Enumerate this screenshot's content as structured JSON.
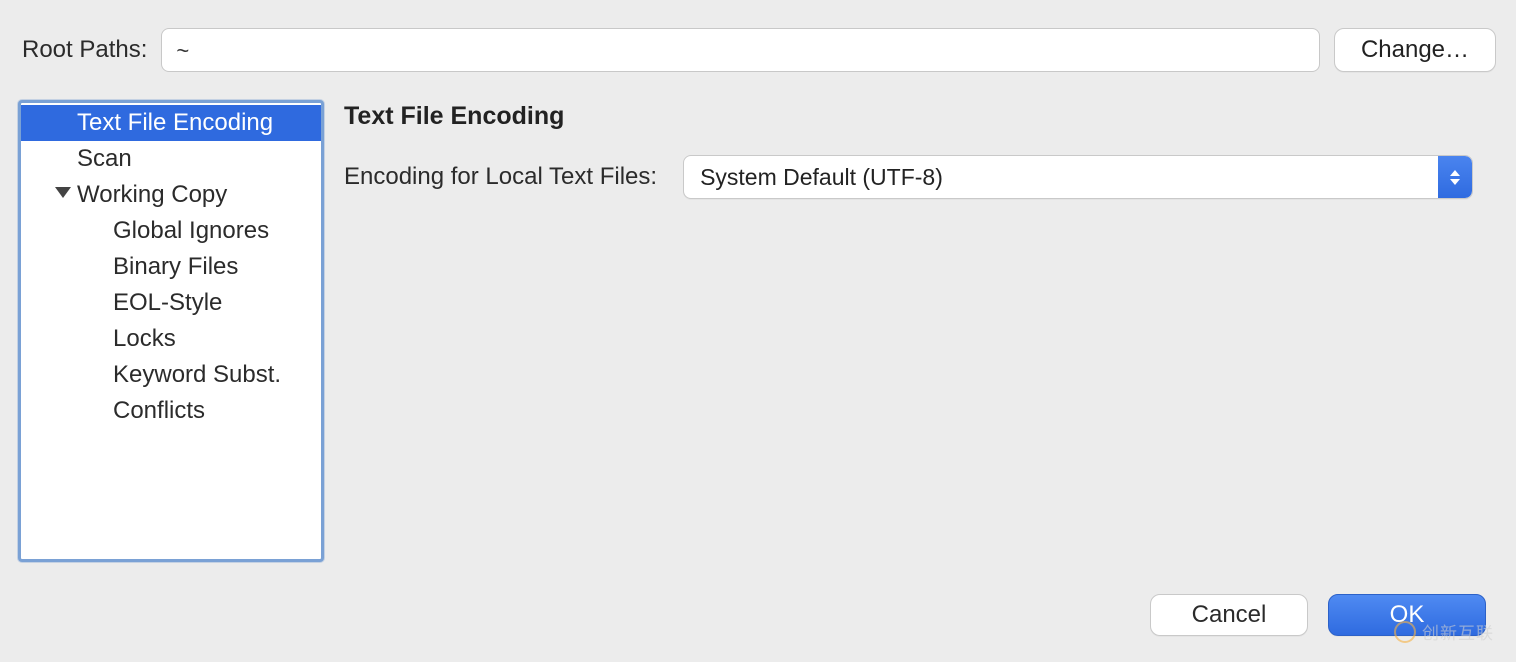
{
  "top": {
    "root_paths_label": "Root Paths:",
    "root_paths_value": "~",
    "change_label": "Change…"
  },
  "sidebar": {
    "items": [
      {
        "label": "Text File Encoding",
        "indent": "item",
        "selected": true
      },
      {
        "label": "Scan",
        "indent": "item",
        "selected": false
      },
      {
        "label": "Working Copy",
        "indent": "group",
        "selected": false
      },
      {
        "label": "Global Ignores",
        "indent": "child",
        "selected": false
      },
      {
        "label": "Binary Files",
        "indent": "child",
        "selected": false
      },
      {
        "label": "EOL-Style",
        "indent": "child",
        "selected": false
      },
      {
        "label": "Locks",
        "indent": "child",
        "selected": false
      },
      {
        "label": "Keyword Subst.",
        "indent": "child",
        "selected": false
      },
      {
        "label": "Conflicts",
        "indent": "child",
        "selected": false
      }
    ]
  },
  "content": {
    "heading": "Text File Encoding",
    "encoding_label": "Encoding for Local Text Files:",
    "encoding_value": "System Default (UTF-8)"
  },
  "buttons": {
    "cancel": "Cancel",
    "ok": "OK"
  },
  "watermark": "创新互联"
}
